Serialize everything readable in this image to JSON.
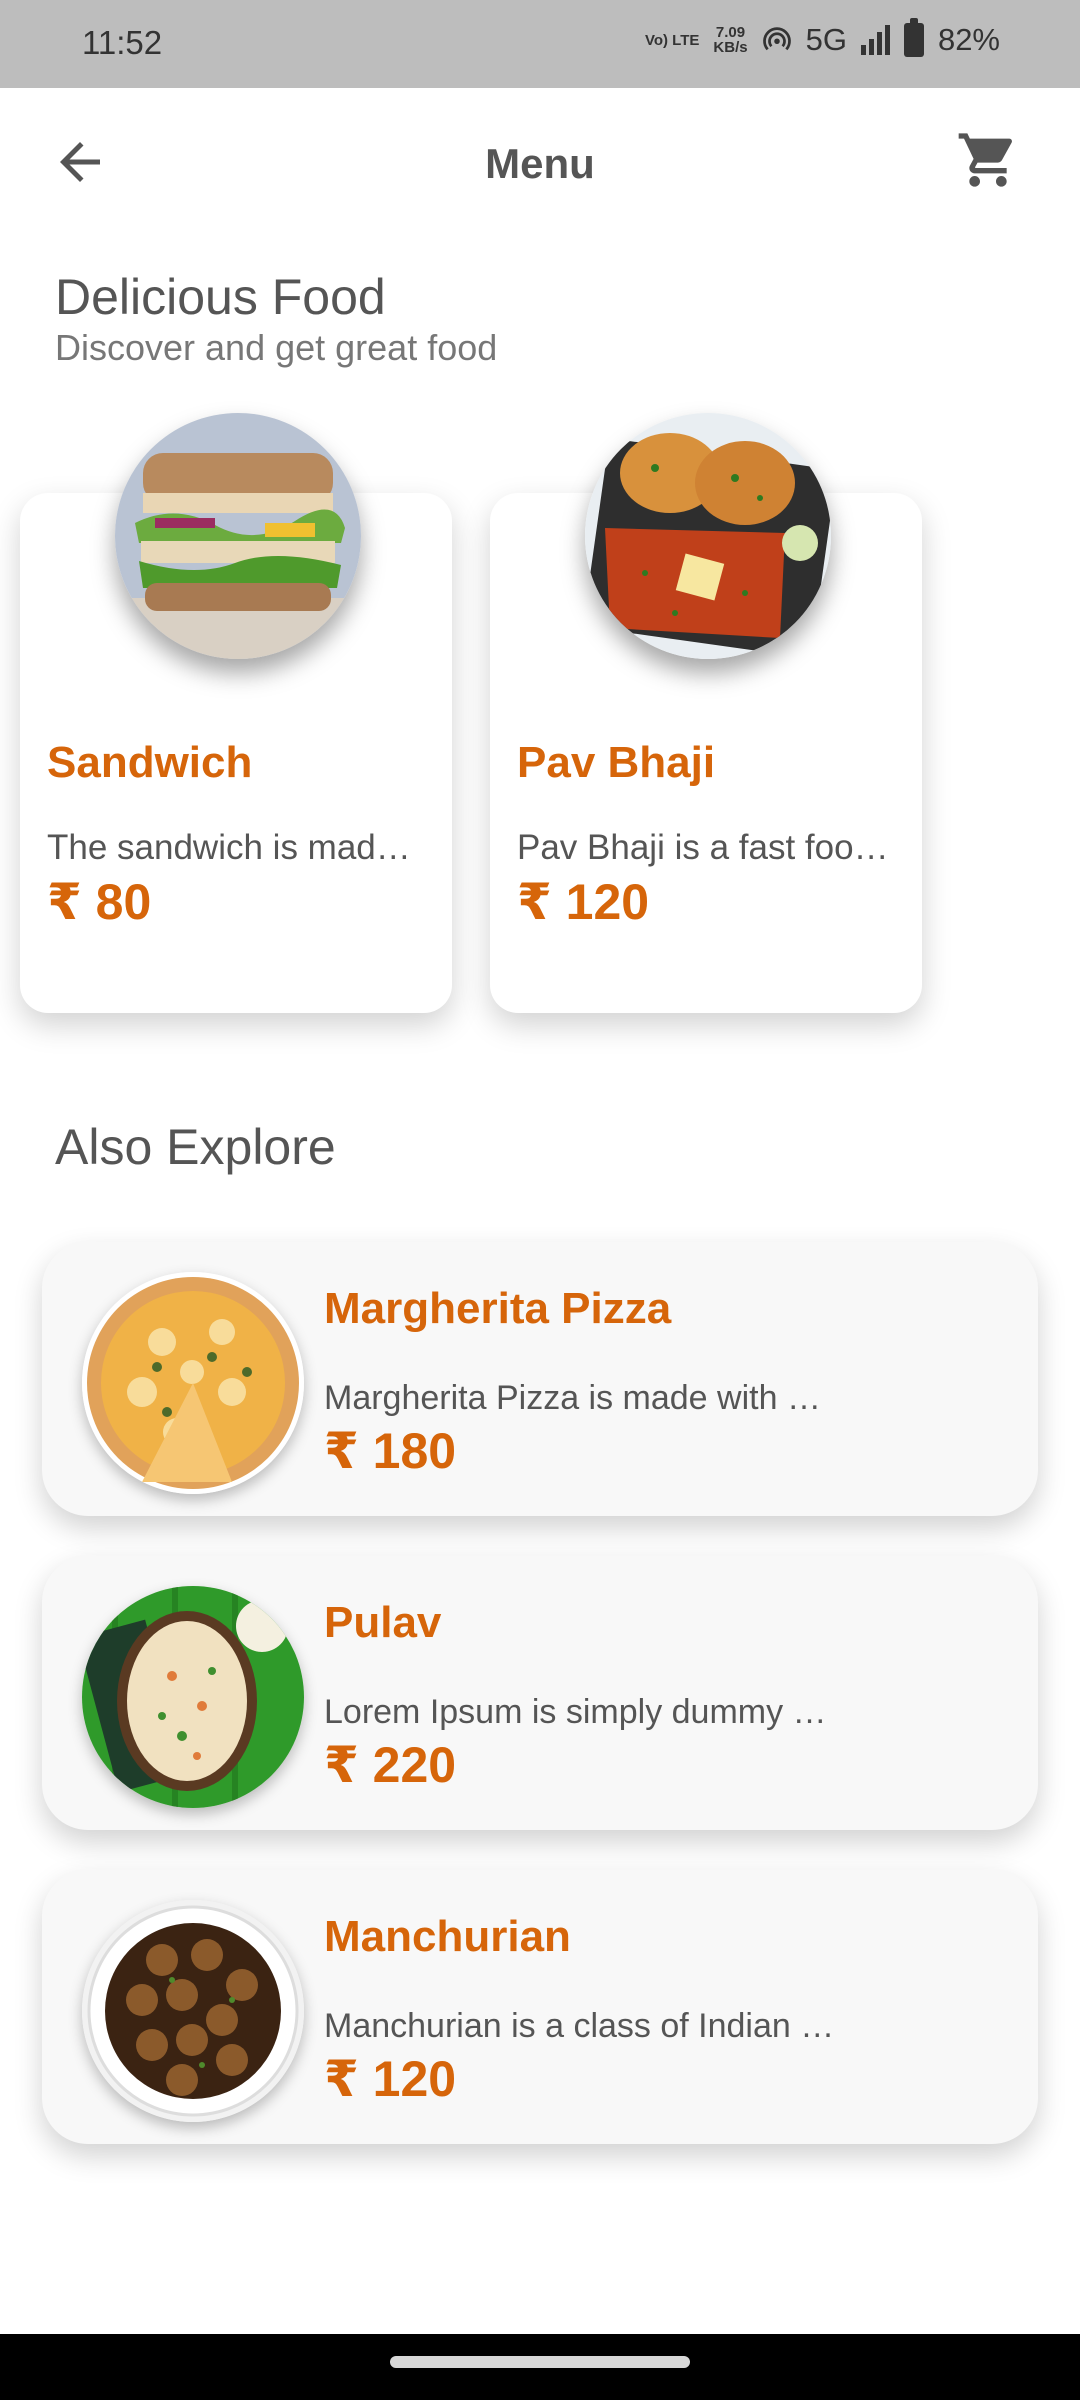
{
  "status": {
    "time": "11:52",
    "volte": "Vo) LTE",
    "speed_value": "7.09",
    "speed_unit": "KB/s",
    "network": "5G",
    "battery": "82%"
  },
  "appbar": {
    "title": "Menu"
  },
  "featured": {
    "title": "Delicious Food",
    "subtitle": "Discover and get great food",
    "items": [
      {
        "name": "Sandwich",
        "desc": "The sandwich is mad…",
        "price": "₹ 80"
      },
      {
        "name": "Pav Bhaji",
        "desc": "Pav Bhaji is a fast foo…",
        "price": "₹ 120"
      }
    ]
  },
  "explore": {
    "title": "Also Explore",
    "items": [
      {
        "name": "Margherita Pizza",
        "desc": "Margherita Pizza is made with …",
        "price": "₹ 180"
      },
      {
        "name": "Pulav",
        "desc": "Lorem Ipsum is simply dummy …",
        "price": "₹ 220"
      },
      {
        "name": "Manchurian",
        "desc": "Manchurian is a class of Indian …",
        "price": "₹ 120"
      }
    ]
  },
  "colors": {
    "accent": "#d6650a",
    "text": "#555555",
    "statusbar": "#bdbdbd"
  }
}
